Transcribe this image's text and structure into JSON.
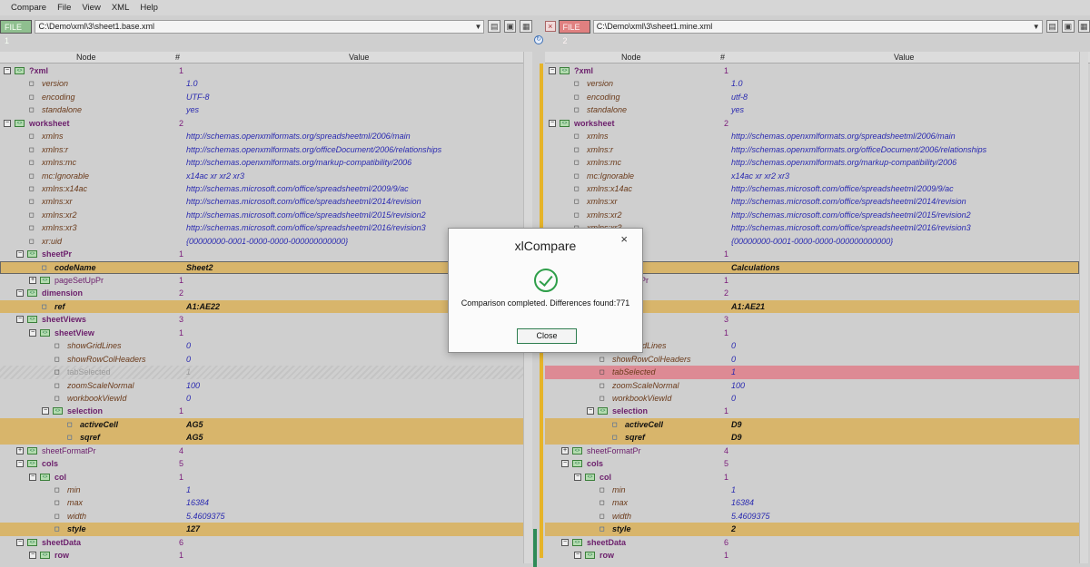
{
  "menu": [
    "Compare",
    "File",
    "View",
    "XML",
    "Help"
  ],
  "left": {
    "badge": "FILE 1",
    "path": "C:\\Demo\\xml\\3\\sheet1.base.xml"
  },
  "right": {
    "badge": "FILE 2",
    "path": "C:\\Demo\\xml\\3\\sheet1.mine.xml"
  },
  "columns": {
    "node": "Node",
    "num": "#",
    "value": "Value"
  },
  "leftRows": [
    {
      "t": "el",
      "lvl": 0,
      "exp": "−",
      "name": "?xml",
      "num": "1",
      "val": ""
    },
    {
      "t": "at",
      "lvl": 1,
      "name": "version",
      "num": "",
      "val": "1.0"
    },
    {
      "t": "at",
      "lvl": 1,
      "name": "encoding",
      "num": "",
      "val": "UTF-8"
    },
    {
      "t": "at",
      "lvl": 1,
      "name": "standalone",
      "num": "",
      "val": "yes"
    },
    {
      "t": "el",
      "lvl": 0,
      "exp": "−",
      "name": "worksheet",
      "num": "2",
      "val": ""
    },
    {
      "t": "at",
      "lvl": 1,
      "name": "xmlns",
      "num": "",
      "val": "http://schemas.openxmlformats.org/spreadsheetml/2006/main"
    },
    {
      "t": "at",
      "lvl": 1,
      "name": "xmlns:r",
      "num": "",
      "val": "http://schemas.openxmlformats.org/officeDocument/2006/relationships"
    },
    {
      "t": "at",
      "lvl": 1,
      "name": "xmlns:mc",
      "num": "",
      "val": "http://schemas.openxmlformats.org/markup-compatibility/2006"
    },
    {
      "t": "at",
      "lvl": 1,
      "name": "mc:Ignorable",
      "num": "",
      "val": "x14ac xr xr2 xr3"
    },
    {
      "t": "at",
      "lvl": 1,
      "name": "xmlns:x14ac",
      "num": "",
      "val": "http://schemas.microsoft.com/office/spreadsheetml/2009/9/ac"
    },
    {
      "t": "at",
      "lvl": 1,
      "name": "xmlns:xr",
      "num": "",
      "val": "http://schemas.microsoft.com/office/spreadsheetml/2014/revision"
    },
    {
      "t": "at",
      "lvl": 1,
      "name": "xmlns:xr2",
      "num": "",
      "val": "http://schemas.microsoft.com/office/spreadsheetml/2015/revision2"
    },
    {
      "t": "at",
      "lvl": 1,
      "name": "xmlns:xr3",
      "num": "",
      "val": "http://schemas.microsoft.com/office/spreadsheetml/2016/revision3"
    },
    {
      "t": "at",
      "lvl": 1,
      "name": "xr:uid",
      "num": "",
      "val": "{00000000-0001-0000-0000-000000000000}"
    },
    {
      "t": "el",
      "lvl": 1,
      "exp": "−",
      "name": "sheetPr",
      "num": "1",
      "val": ""
    },
    {
      "t": "ch",
      "lvl": 2,
      "name": "codeName",
      "num": "",
      "val": "Sheet2",
      "sel": true
    },
    {
      "t": "el",
      "lvl": 2,
      "exp": "+",
      "plain": true,
      "name": "pageSetUpPr",
      "num": "1",
      "val": ""
    },
    {
      "t": "el",
      "lvl": 1,
      "exp": "−",
      "name": "dimension",
      "num": "2",
      "val": ""
    },
    {
      "t": "ch",
      "lvl": 2,
      "name": "ref",
      "num": "",
      "val": "A1:AE22"
    },
    {
      "t": "el",
      "lvl": 1,
      "exp": "−",
      "name": "sheetViews",
      "num": "3",
      "val": ""
    },
    {
      "t": "el",
      "lvl": 2,
      "exp": "−",
      "name": "sheetView",
      "num": "1",
      "val": ""
    },
    {
      "t": "at",
      "lvl": 3,
      "name": "showGridLines",
      "num": "",
      "val": "0"
    },
    {
      "t": "at",
      "lvl": 3,
      "name": "showRowColHeaders",
      "num": "",
      "val": "0"
    },
    {
      "t": "gh",
      "lvl": 3,
      "name": "tabSelected",
      "num": "",
      "val": "1"
    },
    {
      "t": "at",
      "lvl": 3,
      "name": "zoomScaleNormal",
      "num": "",
      "val": "100"
    },
    {
      "t": "at",
      "lvl": 3,
      "name": "workbookViewId",
      "num": "",
      "val": "0"
    },
    {
      "t": "el",
      "lvl": 3,
      "exp": "−",
      "name": "selection",
      "num": "1",
      "val": ""
    },
    {
      "t": "ch",
      "lvl": 4,
      "name": "activeCell",
      "num": "",
      "val": "AG5"
    },
    {
      "t": "ch",
      "lvl": 4,
      "name": "sqref",
      "num": "",
      "val": "AG5"
    },
    {
      "t": "el",
      "lvl": 1,
      "exp": "+",
      "plain": true,
      "name": "sheetFormatPr",
      "num": "4",
      "val": ""
    },
    {
      "t": "el",
      "lvl": 1,
      "exp": "−",
      "name": "cols",
      "num": "5",
      "val": ""
    },
    {
      "t": "el",
      "lvl": 2,
      "exp": "−",
      "name": "col",
      "num": "1",
      "val": ""
    },
    {
      "t": "at",
      "lvl": 3,
      "name": "min",
      "num": "",
      "val": "1"
    },
    {
      "t": "at",
      "lvl": 3,
      "name": "max",
      "num": "",
      "val": "16384"
    },
    {
      "t": "at",
      "lvl": 3,
      "name": "width",
      "num": "",
      "val": "5.4609375"
    },
    {
      "t": "ch",
      "lvl": 3,
      "name": "style",
      "num": "",
      "val": "127"
    },
    {
      "t": "el",
      "lvl": 1,
      "exp": "−",
      "name": "sheetData",
      "num": "6",
      "val": ""
    },
    {
      "t": "el",
      "lvl": 2,
      "exp": "−",
      "name": "row",
      "num": "1",
      "val": ""
    }
  ],
  "rightRows": [
    {
      "t": "el",
      "lvl": 0,
      "exp": "−",
      "name": "?xml",
      "num": "1",
      "val": ""
    },
    {
      "t": "at",
      "lvl": 1,
      "name": "version",
      "num": "",
      "val": "1.0"
    },
    {
      "t": "at",
      "lvl": 1,
      "name": "encoding",
      "num": "",
      "val": "utf-8"
    },
    {
      "t": "at",
      "lvl": 1,
      "name": "standalone",
      "num": "",
      "val": "yes"
    },
    {
      "t": "el",
      "lvl": 0,
      "exp": "−",
      "name": "worksheet",
      "num": "2",
      "val": ""
    },
    {
      "t": "at",
      "lvl": 1,
      "name": "xmlns",
      "num": "",
      "val": "http://schemas.openxmlformats.org/spreadsheetml/2006/main"
    },
    {
      "t": "at",
      "lvl": 1,
      "name": "xmlns:r",
      "num": "",
      "val": "http://schemas.openxmlformats.org/officeDocument/2006/relationships"
    },
    {
      "t": "at",
      "lvl": 1,
      "name": "xmlns:mc",
      "num": "",
      "val": "http://schemas.openxmlformats.org/markup-compatibility/2006"
    },
    {
      "t": "at",
      "lvl": 1,
      "name": "mc:Ignorable",
      "num": "",
      "val": "x14ac xr xr2 xr3"
    },
    {
      "t": "at",
      "lvl": 1,
      "name": "xmlns:x14ac",
      "num": "",
      "val": "http://schemas.microsoft.com/office/spreadsheetml/2009/9/ac"
    },
    {
      "t": "at",
      "lvl": 1,
      "name": "xmlns:xr",
      "num": "",
      "val": "http://schemas.microsoft.com/office/spreadsheetml/2014/revision"
    },
    {
      "t": "at",
      "lvl": 1,
      "name": "xmlns:xr2",
      "num": "",
      "val": "http://schemas.microsoft.com/office/spreadsheetml/2015/revision2"
    },
    {
      "t": "at",
      "lvl": 1,
      "name": "xmlns:xr3",
      "num": "",
      "val": "http://schemas.microsoft.com/office/spreadsheetml/2016/revision3"
    },
    {
      "t": "at",
      "lvl": 1,
      "name": "xr:uid",
      "num": "",
      "val": "{00000000-0001-0000-0000-000000000000}"
    },
    {
      "t": "el",
      "lvl": 1,
      "exp": "−",
      "name": "sheetPr",
      "num": "1",
      "val": ""
    },
    {
      "t": "ch",
      "lvl": 2,
      "name": "codeName",
      "num": "",
      "val": "Calculations",
      "sel": true
    },
    {
      "t": "el",
      "lvl": 2,
      "exp": "+",
      "plain": true,
      "name": "pageSetUpPr",
      "num": "1",
      "val": ""
    },
    {
      "t": "el",
      "lvl": 1,
      "exp": "−",
      "name": "dimension",
      "num": "2",
      "val": ""
    },
    {
      "t": "ch",
      "lvl": 2,
      "name": "ref",
      "num": "",
      "val": "A1:AE21"
    },
    {
      "t": "el",
      "lvl": 1,
      "exp": "−",
      "name": "sheetViews",
      "num": "3",
      "val": ""
    },
    {
      "t": "el",
      "lvl": 2,
      "exp": "−",
      "name": "sheetView",
      "num": "1",
      "val": ""
    },
    {
      "t": "at",
      "lvl": 3,
      "name": "showGridLines",
      "num": "",
      "val": "0"
    },
    {
      "t": "at",
      "lvl": 3,
      "name": "showRowColHeaders",
      "num": "",
      "val": "0"
    },
    {
      "t": "red",
      "lvl": 3,
      "name": "tabSelected",
      "num": "",
      "val": "1"
    },
    {
      "t": "at",
      "lvl": 3,
      "name": "zoomScaleNormal",
      "num": "",
      "val": "100"
    },
    {
      "t": "at",
      "lvl": 3,
      "name": "workbookViewId",
      "num": "",
      "val": "0"
    },
    {
      "t": "el",
      "lvl": 3,
      "exp": "−",
      "name": "selection",
      "num": "1",
      "val": ""
    },
    {
      "t": "ch",
      "lvl": 4,
      "name": "activeCell",
      "num": "",
      "val": "D9"
    },
    {
      "t": "ch",
      "lvl": 4,
      "name": "sqref",
      "num": "",
      "val": "D9"
    },
    {
      "t": "el",
      "lvl": 1,
      "exp": "+",
      "plain": true,
      "name": "sheetFormatPr",
      "num": "4",
      "val": ""
    },
    {
      "t": "el",
      "lvl": 1,
      "exp": "−",
      "name": "cols",
      "num": "5",
      "val": ""
    },
    {
      "t": "el",
      "lvl": 2,
      "exp": "−",
      "name": "col",
      "num": "1",
      "val": ""
    },
    {
      "t": "at",
      "lvl": 3,
      "name": "min",
      "num": "",
      "val": "1"
    },
    {
      "t": "at",
      "lvl": 3,
      "name": "max",
      "num": "",
      "val": "16384"
    },
    {
      "t": "at",
      "lvl": 3,
      "name": "width",
      "num": "",
      "val": "5.4609375"
    },
    {
      "t": "ch",
      "lvl": 3,
      "name": "style",
      "num": "",
      "val": "2"
    },
    {
      "t": "el",
      "lvl": 1,
      "exp": "−",
      "name": "sheetData",
      "num": "6",
      "val": ""
    },
    {
      "t": "el",
      "lvl": 2,
      "exp": "−",
      "name": "row",
      "num": "1",
      "val": ""
    }
  ],
  "dialog": {
    "title": "xlCompare",
    "close": "×",
    "message": "Comparison completed. Differences found:771",
    "button": "Close"
  },
  "colors": {
    "diff": "#d8b56b",
    "removed": "#dd8a94",
    "strip": "#e6b429",
    "accent": "#2e9e49"
  }
}
